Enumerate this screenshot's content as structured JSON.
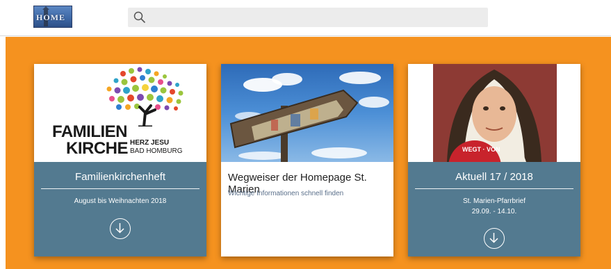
{
  "header": {
    "logo_text": "HOME",
    "search": {
      "placeholder": ""
    }
  },
  "cards": [
    {
      "title": "Familienkirchenheft",
      "subtitle": "August bis Weihnachten 2018",
      "image": {
        "line1": "FAMILIEN",
        "line2": "KIRCHE",
        "line3": "HERZ JESU",
        "line4": "BAD HOMBURG"
      },
      "action_icon": "download-circle-icon"
    },
    {
      "title": "Wegweiser der Homepage St. Marien",
      "subtitle": "Wichtige Informationen schnell finden"
    },
    {
      "title": "Aktuell 17 / 2018",
      "subtitle_line1": "St. Marien-Pfarrbrief",
      "subtitle_line2": "29.09. - 14.10.",
      "image": {
        "badge_text": "WEGT · VON"
      },
      "action_icon": "download-circle-icon"
    }
  ],
  "colors": {
    "band": "#f5921f",
    "card_blue": "#537a90",
    "search_bg": "#ececec"
  }
}
